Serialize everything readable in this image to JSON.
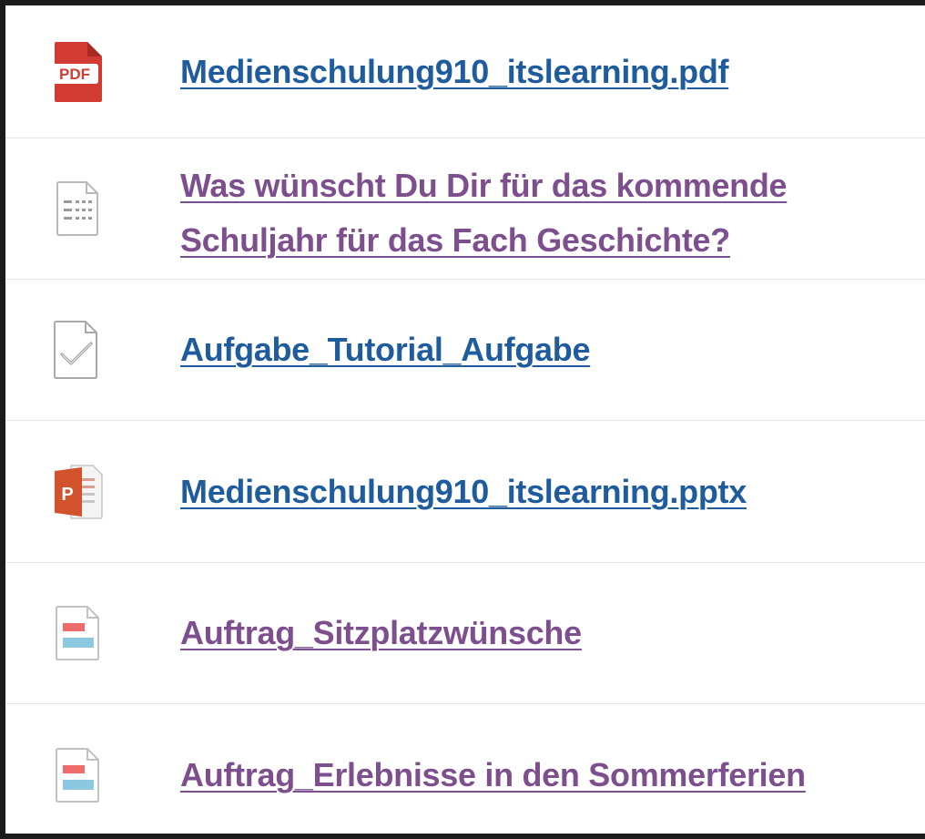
{
  "items": [
    {
      "icon": "pdf-icon",
      "title": "Medienschulung910_itslearning.pdf",
      "state": "unvisited"
    },
    {
      "icon": "survey-icon",
      "title": "Was wünscht Du Dir für das kommende Schuljahr für das Fach Geschichte?",
      "state": "visited"
    },
    {
      "icon": "assignment-check-icon",
      "title": "Aufgabe_Tutorial_Aufgabe",
      "state": "unvisited"
    },
    {
      "icon": "powerpoint-icon",
      "title": "Medienschulung910_itslearning.pptx",
      "state": "unvisited"
    },
    {
      "icon": "page-icon",
      "title": "Auftrag_Sitzplatzwünsche",
      "state": "visited"
    },
    {
      "icon": "page-icon",
      "title": "Auftrag_Erlebnisse in den Sommerferien",
      "state": "visited"
    }
  ],
  "colors": {
    "link_unvisited": "#1f5c9e",
    "link_visited": "#7e4f8e",
    "pdf_red": "#d23b32",
    "ppt_orange": "#d2522d",
    "page_red": "#ef6b6b",
    "page_blue": "#8cc8e0"
  }
}
